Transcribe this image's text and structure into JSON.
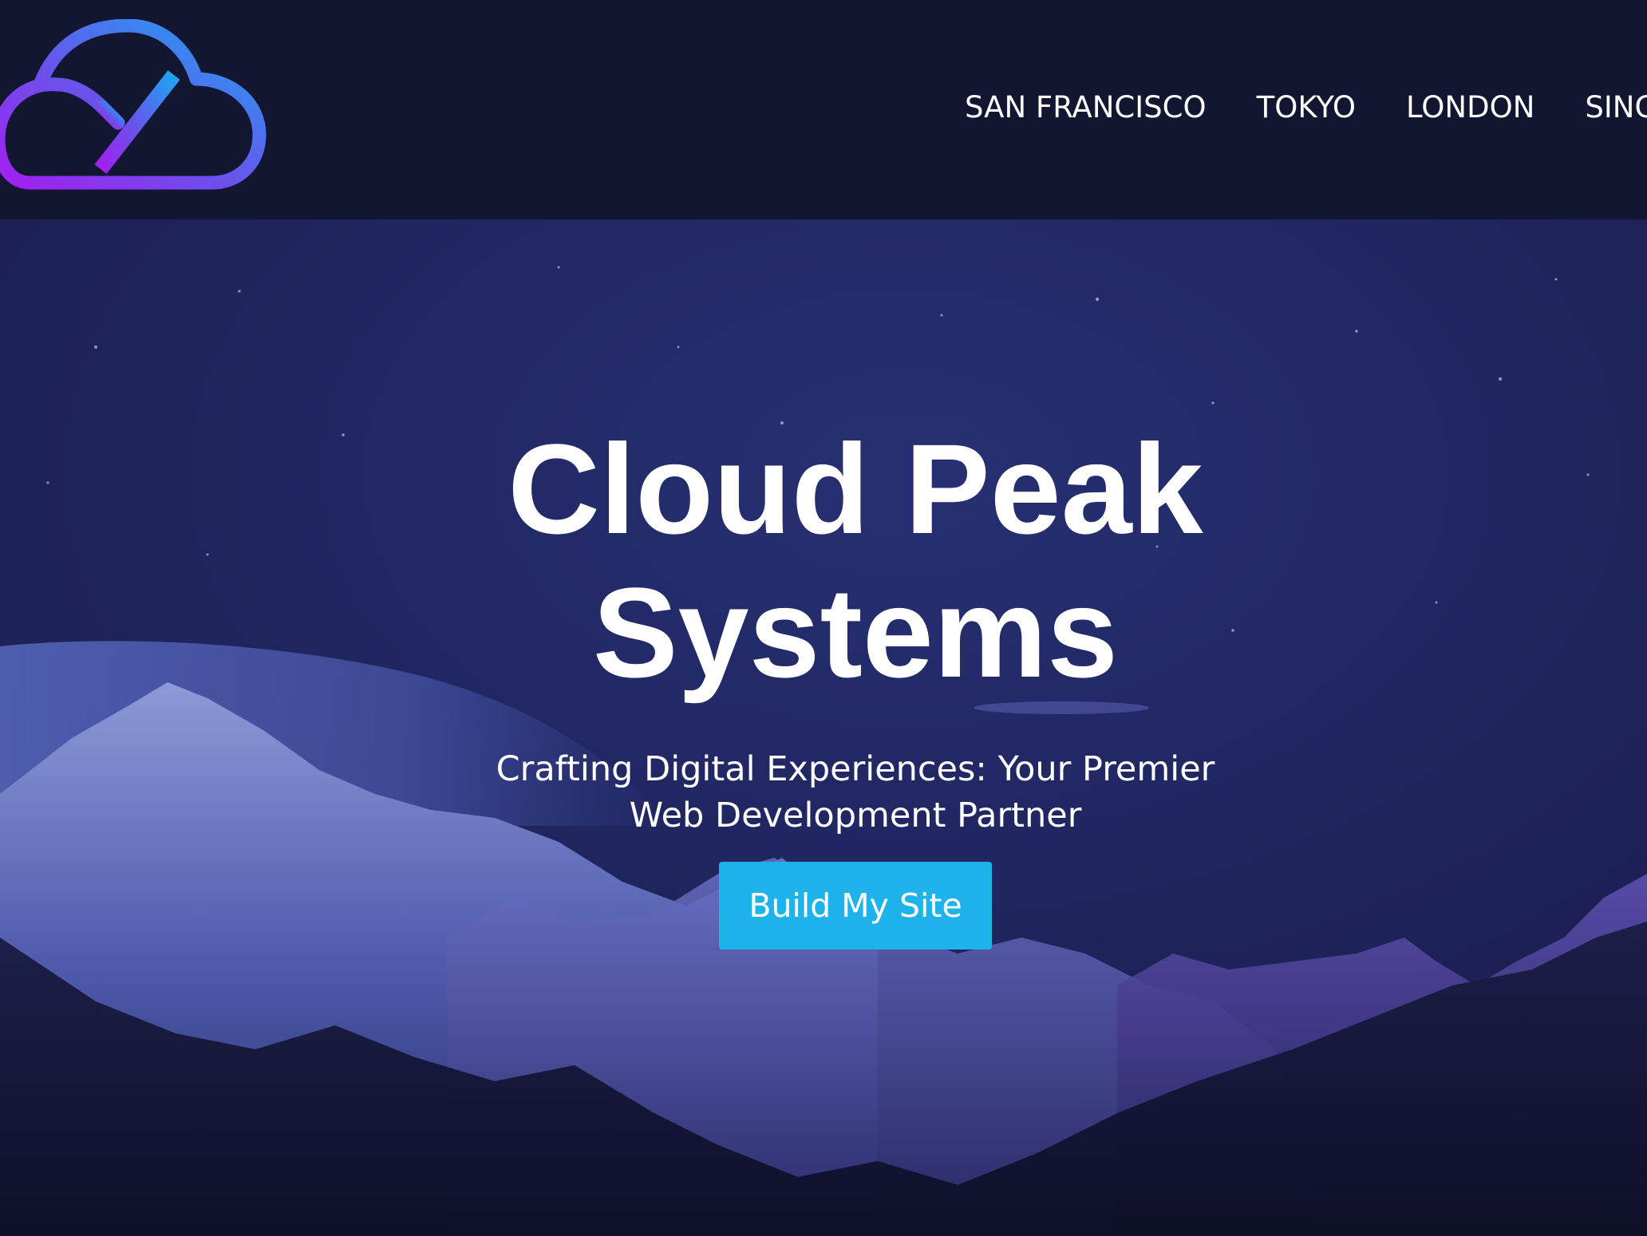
{
  "header": {
    "logo_name": "cloud-logo-icon",
    "nav": [
      {
        "label": "SAN FRANCISCO"
      },
      {
        "label": "TOKYO"
      },
      {
        "label": "LONDON"
      },
      {
        "label": "SINGA"
      }
    ]
  },
  "hero": {
    "title_line1": "Cloud Peak",
    "title_line2": "Systems",
    "subtitle": "Crafting Digital Experiences: Your Premier Web Development Partner",
    "cta_label": "Build My Site"
  },
  "colors": {
    "header_bg": "#131631",
    "accent_button": "#1fb3ec",
    "logo_gradient_start": "#1ea5f2",
    "logo_gradient_end": "#a21ff0",
    "text": "#ffffff"
  }
}
